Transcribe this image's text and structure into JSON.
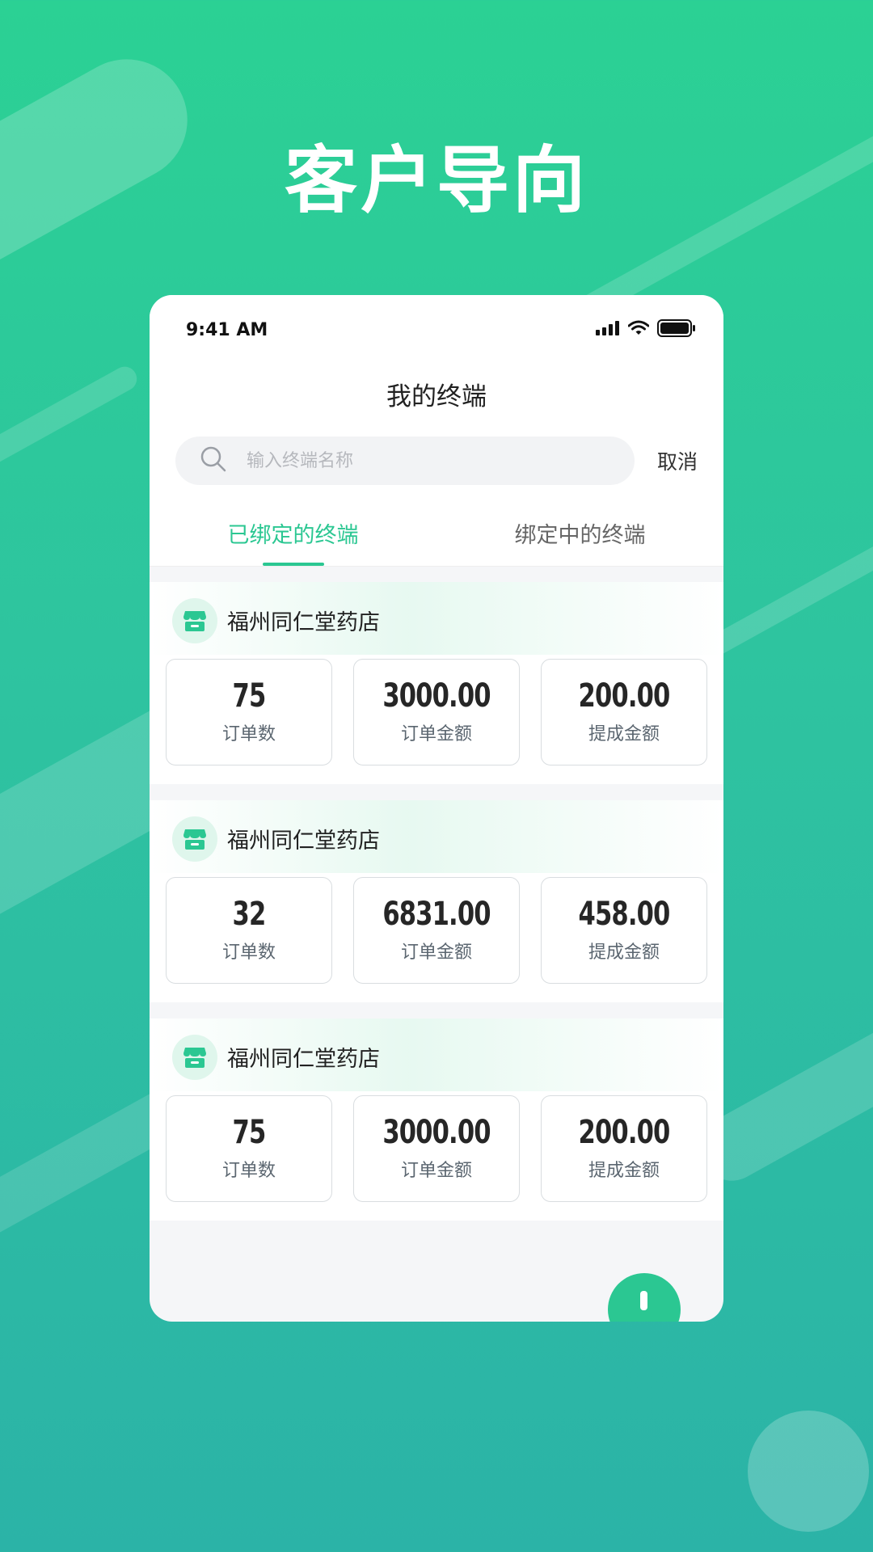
{
  "hero": {
    "title": "客户导向"
  },
  "status_bar": {
    "time": "9:41 AM"
  },
  "nav": {
    "title": "我的终端"
  },
  "search": {
    "placeholder": "输入终端名称",
    "value": "",
    "cancel_label": "取消"
  },
  "tabs": [
    {
      "label": "已绑定的终端",
      "active": true
    },
    {
      "label": "绑定中的终端",
      "active": false
    }
  ],
  "terminals": [
    {
      "name": "福州同仁堂药店",
      "stats": [
        {
          "value": "75",
          "label": "订单数"
        },
        {
          "value": "3000.00",
          "label": "订单金额"
        },
        {
          "value": "200.00",
          "label": "提成金额"
        }
      ]
    },
    {
      "name": "福州同仁堂药店",
      "stats": [
        {
          "value": "32",
          "label": "订单数"
        },
        {
          "value": "6831.00",
          "label": "订单金额"
        },
        {
          "value": "458.00",
          "label": "提成金额"
        }
      ]
    },
    {
      "name": "福州同仁堂药店",
      "stats": [
        {
          "value": "75",
          "label": "订单数"
        },
        {
          "value": "3000.00",
          "label": "订单金额"
        },
        {
          "value": "200.00",
          "label": "提成金额"
        }
      ]
    }
  ],
  "icons": {
    "search": "search-icon",
    "store": "store-icon",
    "signal": "signal-icon",
    "wifi": "wifi-icon",
    "battery": "battery-icon"
  },
  "colors": {
    "accent": "#2bc792",
    "background_top": "#2bd194",
    "background_bottom": "#2bb3a7"
  }
}
